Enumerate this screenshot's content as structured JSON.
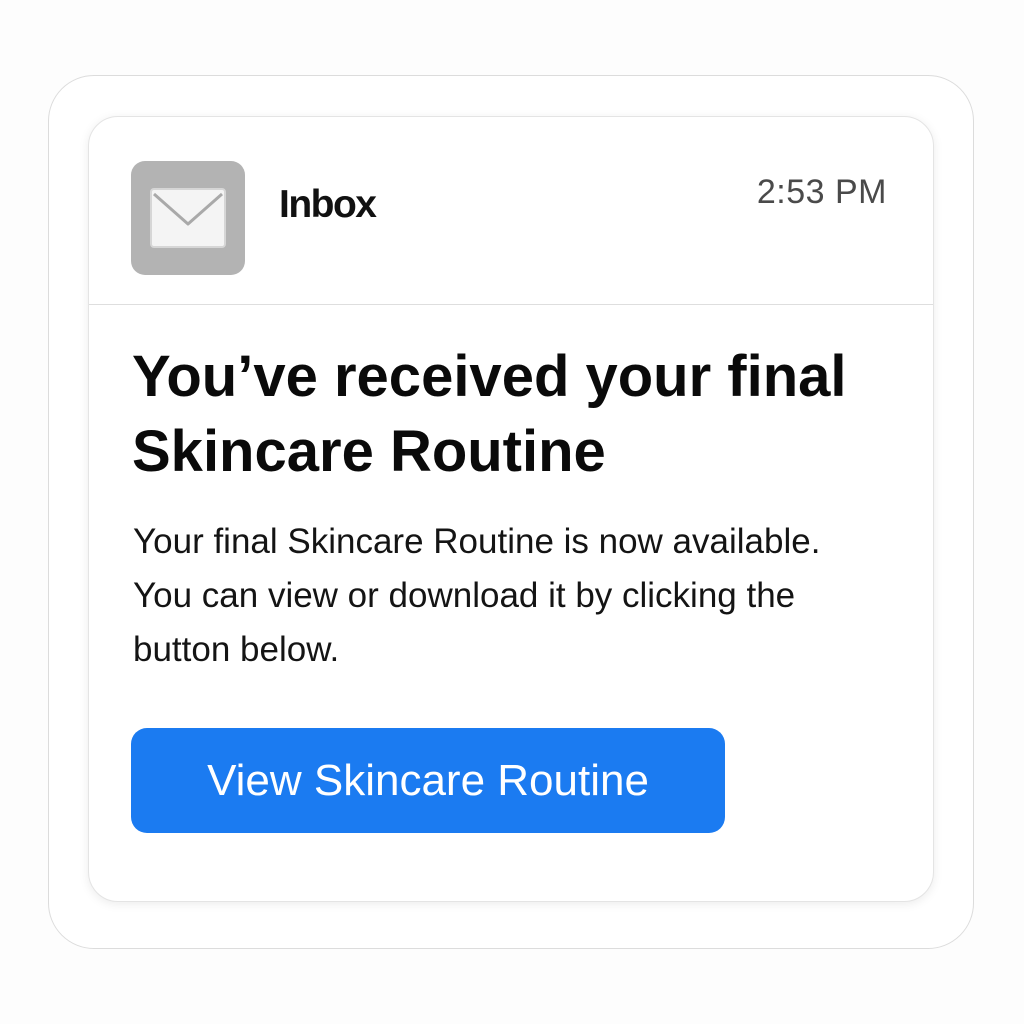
{
  "header": {
    "app_icon": "envelope-icon",
    "title": "Inbox",
    "time": "2:53 PM"
  },
  "message": {
    "title": "You’ve received your final Skincare Routine",
    "body": "Your final Skincare Routine is now available. You can view or download it by clicking the button below.",
    "button_label": "View Skincare Routine"
  },
  "colors": {
    "accent": "#1b7bf1",
    "icon_background": "#b3b3b3"
  }
}
